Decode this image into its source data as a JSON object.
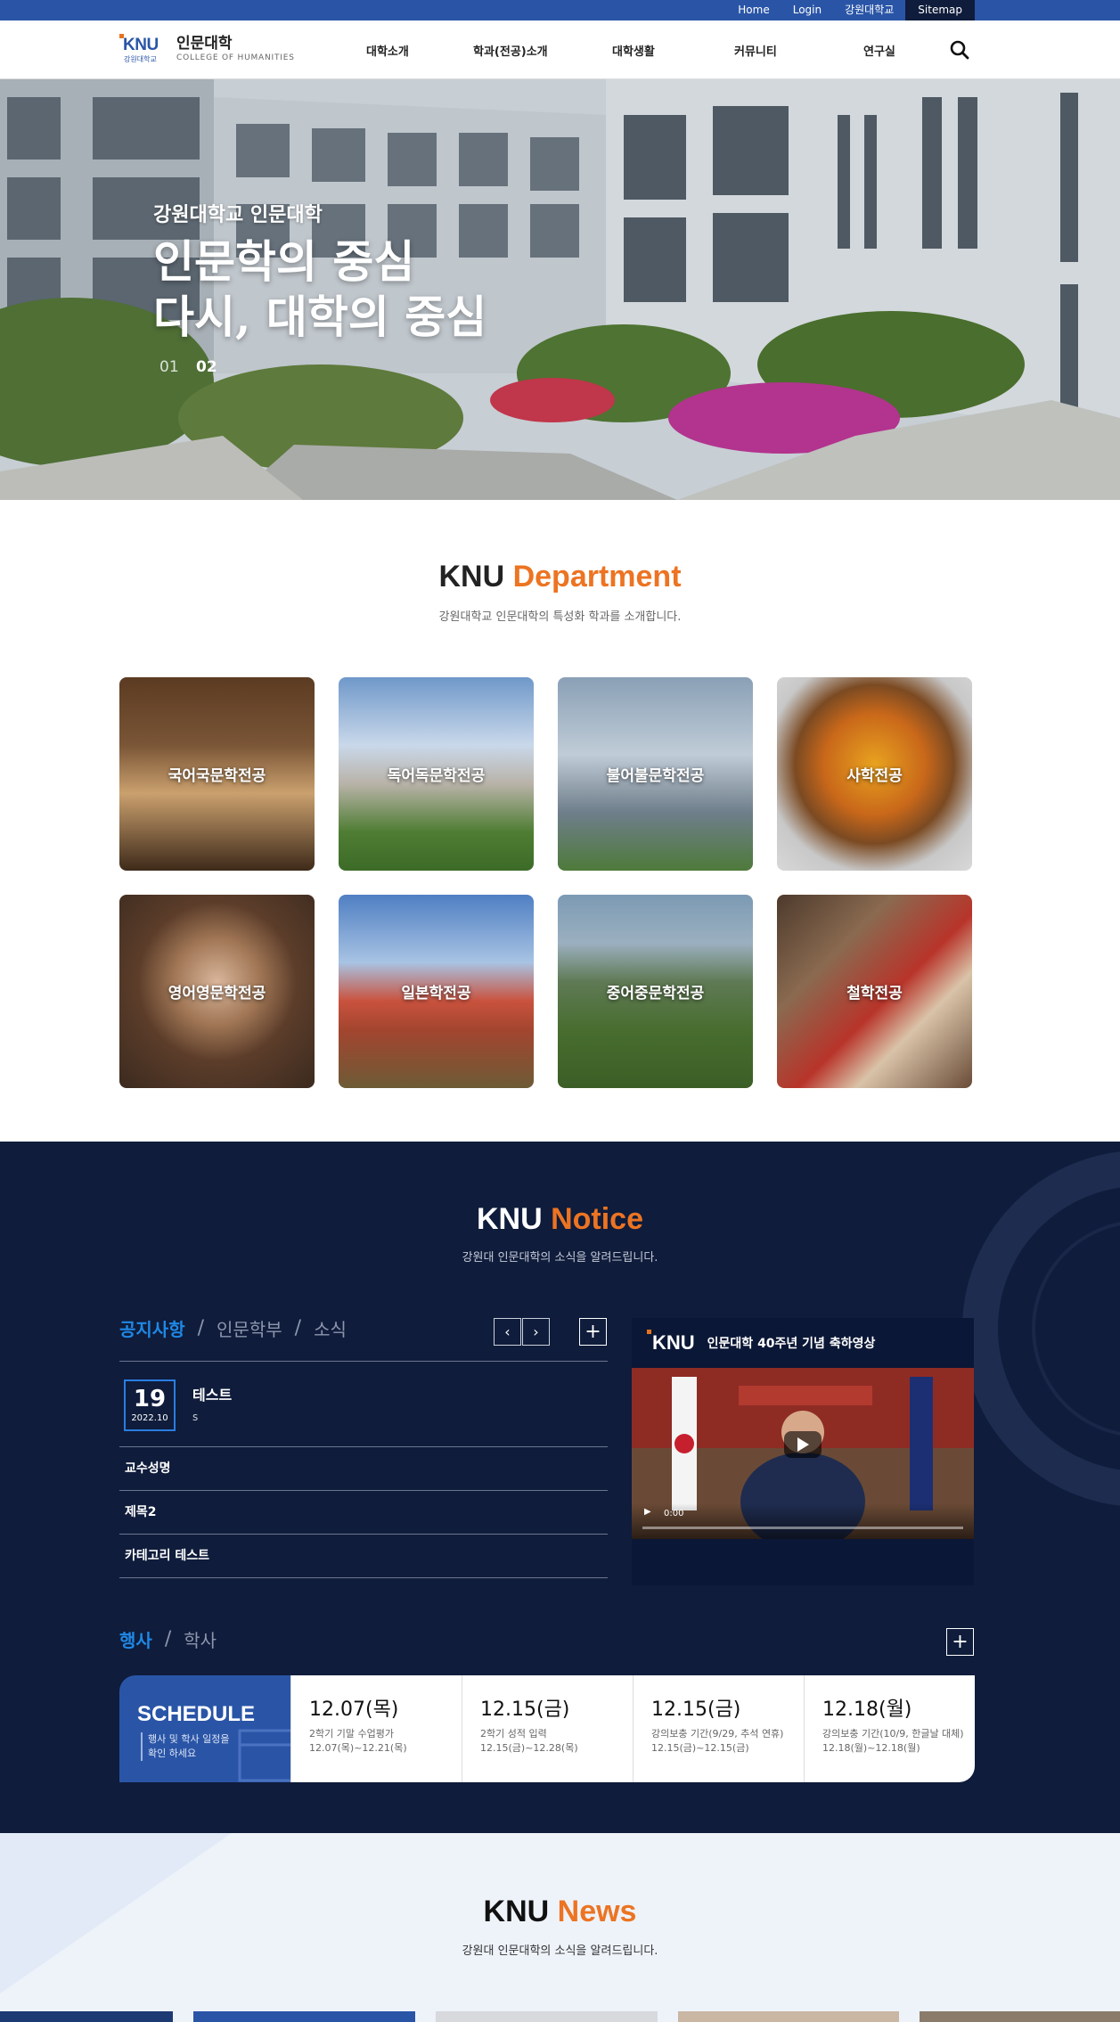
{
  "util_nav": [
    "Home",
    "Login",
    "강원대학교",
    "Sitemap"
  ],
  "logo": {
    "mark": "KNU",
    "mark_sub": "강원대학교",
    "name_ko": "인문대학",
    "name_en": "COLLEGE OF HUMANITIES"
  },
  "gnb": [
    "대학소개",
    "학과(전공)소개",
    "대학생활",
    "커뮤니티",
    "연구실"
  ],
  "hero": {
    "subtitle": "강원대학교 인문대학",
    "title_line1": "인문학의 중심",
    "title_line2": "다시, 대학의 중심",
    "pager": [
      "01",
      "02"
    ],
    "active_page": "02"
  },
  "department": {
    "title_main": "KNU",
    "title_accent": "Department",
    "desc": "강원대학교 인문대학의 특성화 학과를 소개합니다.",
    "items": [
      "국어국문학전공",
      "독어독문학전공",
      "불어불문학전공",
      "사학전공",
      "영어영문학전공",
      "일본학전공",
      "중어중문학전공",
      "철학전공"
    ]
  },
  "notice": {
    "title_main": "KNU",
    "title_accent": "Notice",
    "desc": "강원대 인문대학의 소식을 알려드립니다.",
    "tabs": [
      "공지사항",
      "인문학부",
      "소식"
    ],
    "featured": {
      "day": "19",
      "ym": "2022.10",
      "title": "테스트",
      "excerpt": "s"
    },
    "items": [
      "교수성명",
      "제목2",
      "카테고리 테스트"
    ],
    "video": {
      "logo": "KNU",
      "title": "인문대학 40주년 기념 축하영상",
      "time": "0:00"
    },
    "event_tabs": [
      "행사",
      "학사"
    ],
    "schedule": {
      "label": "SCHEDULE",
      "label_sub": "행사 및 학사 일정을 확인 하세요",
      "items": [
        {
          "date": "12.07(목)",
          "desc": "2학기 기말 수업평가",
          "range": "12.07(목)~12.21(목)"
        },
        {
          "date": "12.15(금)",
          "desc": "2학기 성적 입력",
          "range": "12.15(금)~12.28(목)"
        },
        {
          "date": "12.15(금)",
          "desc": "강의보충 기간(9/29, 추석 연휴)",
          "range": "12.15(금)~12.15(금)"
        },
        {
          "date": "12.18(월)",
          "desc": "강의보충 기간(10/9, 한글날 대체)",
          "range": "12.18(월)~12.18(월)"
        }
      ]
    }
  },
  "news": {
    "title_main": "KNU",
    "title_accent": "News",
    "desc": "강원대 인문대학의 소식을 알려드립니다."
  },
  "colors": {
    "primary": "#2a55a7",
    "accent": "#ec7422",
    "navy": "#0f1c3b",
    "tab_active": "#1f88e5"
  }
}
